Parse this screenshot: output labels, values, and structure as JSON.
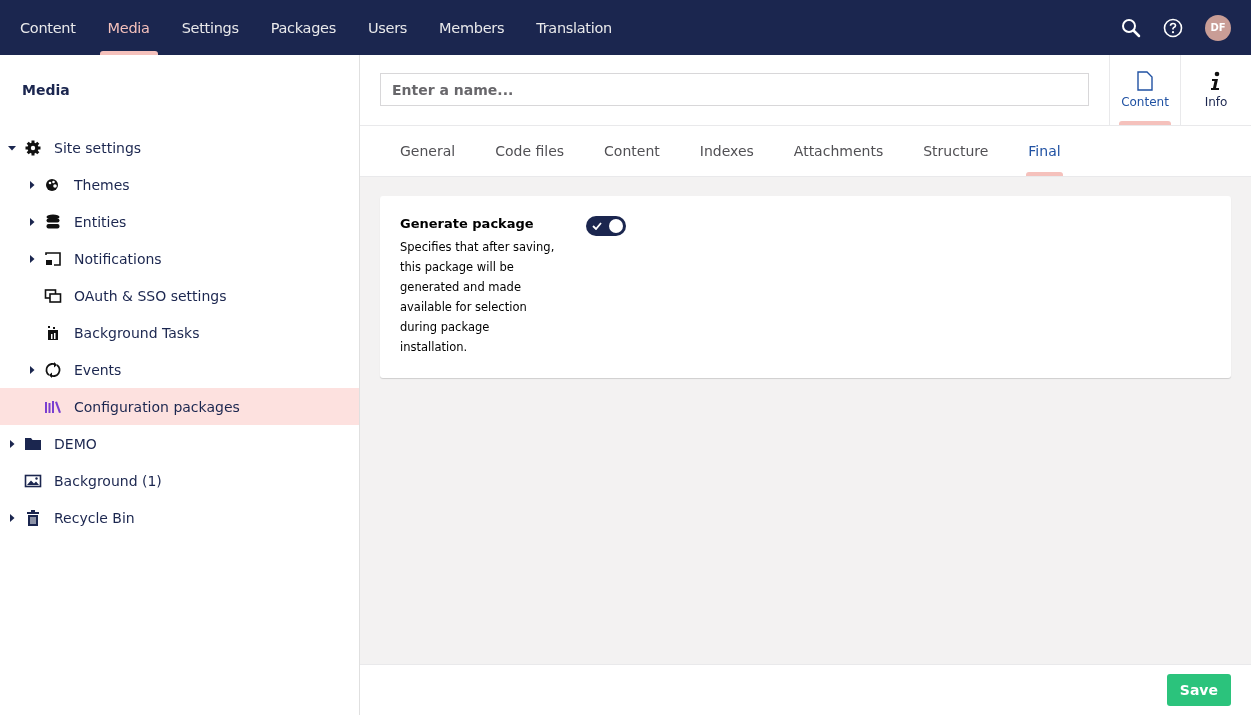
{
  "top_nav": {
    "sections": [
      {
        "label": "Content",
        "selected": false
      },
      {
        "label": "Media",
        "selected": true
      },
      {
        "label": "Settings",
        "selected": false
      },
      {
        "label": "Packages",
        "selected": false
      },
      {
        "label": "Users",
        "selected": false
      },
      {
        "label": "Members",
        "selected": false
      },
      {
        "label": "Translation",
        "selected": false
      }
    ],
    "avatar": "DF"
  },
  "sidebar": {
    "title": "Media",
    "items": [
      {
        "label": "Site settings",
        "kind": "gear",
        "expanded": true,
        "selected": false,
        "children": [
          {
            "label": "Themes",
            "kind": "palette",
            "expanded": false,
            "selected": false
          },
          {
            "label": "Entities",
            "kind": "database",
            "expanded": false,
            "selected": false
          },
          {
            "label": "Notifications",
            "kind": "cast",
            "expanded": false,
            "selected": false
          },
          {
            "label": "OAuth & SSO settings",
            "kind": "windows",
            "selected": false
          },
          {
            "label": "Background Tasks",
            "kind": "tasks",
            "selected": false
          },
          {
            "label": "Events",
            "kind": "sync",
            "expanded": false,
            "selected": false
          },
          {
            "label": "Configuration packages",
            "kind": "books",
            "selected": true
          }
        ]
      },
      {
        "label": "DEMO",
        "kind": "folder",
        "expanded": false,
        "selected": false
      },
      {
        "label": "Background (1)",
        "kind": "image",
        "selected": false
      },
      {
        "label": "Recycle Bin",
        "kind": "trash",
        "expanded": false,
        "selected": false
      }
    ]
  },
  "editor": {
    "name_placeholder": "Enter a name...",
    "apps": [
      {
        "label": "Content",
        "kind": "document",
        "selected": true
      },
      {
        "label": "Info",
        "kind": "info",
        "selected": false
      }
    ],
    "tabs": [
      {
        "label": "General",
        "selected": false
      },
      {
        "label": "Code files",
        "selected": false
      },
      {
        "label": "Content",
        "selected": false
      },
      {
        "label": "Indexes",
        "selected": false
      },
      {
        "label": "Attachments",
        "selected": false
      },
      {
        "label": "Structure",
        "selected": false
      },
      {
        "label": "Final",
        "selected": true
      }
    ],
    "property": {
      "label": "Generate package",
      "description": "Specifies that after saving, this package will be generated and made available for selection during package installation.",
      "on": true
    },
    "save_button": "Save"
  }
}
